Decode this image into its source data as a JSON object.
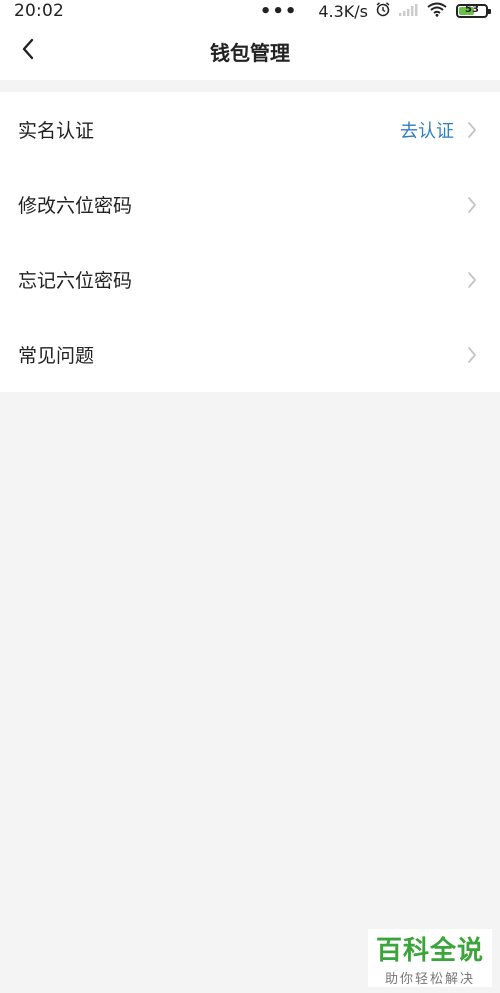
{
  "status_bar": {
    "time": "20:02",
    "dots": "•••",
    "speed": "4.3K/s",
    "battery_level": "53",
    "battery_color": "#6cc04a"
  },
  "nav": {
    "title": "钱包管理",
    "back_icon": "chevron-left-icon"
  },
  "menu": {
    "items": [
      {
        "label": "实名认证",
        "action": "去认证",
        "icon": "chevron-right-icon"
      },
      {
        "label": "修改六位密码",
        "action": "",
        "icon": "chevron-right-icon"
      },
      {
        "label": "忘记六位密码",
        "action": "",
        "icon": "chevron-right-icon"
      },
      {
        "label": "常见问题",
        "action": "",
        "icon": "chevron-right-icon"
      }
    ]
  },
  "colors": {
    "accent": "#2f7fc1",
    "background": "#f4f4f4",
    "card": "#ffffff"
  },
  "watermark": {
    "main": "百科全说",
    "sub": "助你轻松解决"
  }
}
